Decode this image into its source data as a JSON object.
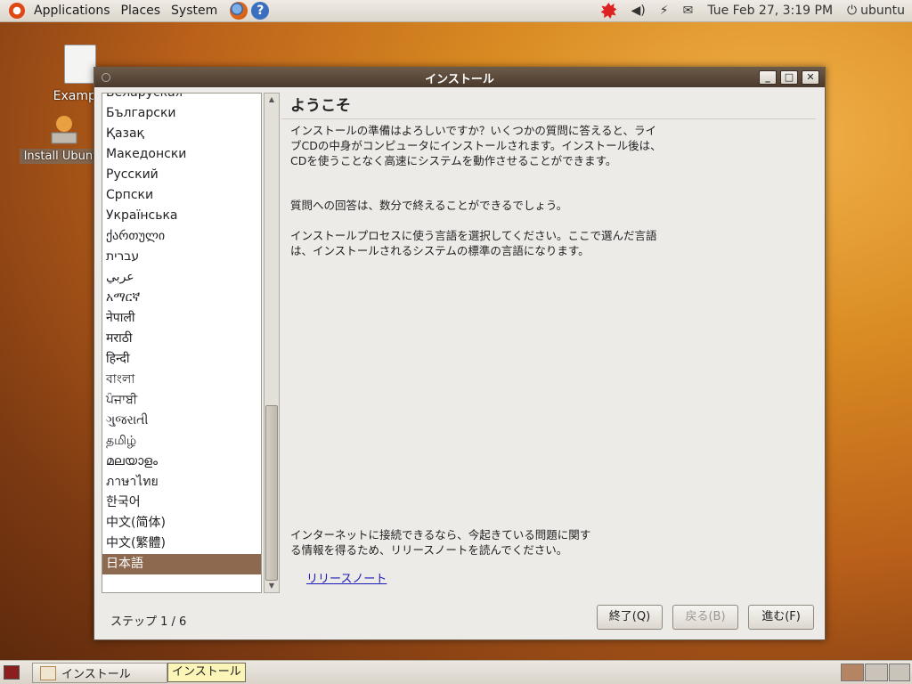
{
  "top_panel": {
    "menus": [
      "Applications",
      "Places",
      "System"
    ],
    "help_glyph": "?",
    "clock": "Tue Feb 27,  3:19 PM",
    "user": "ubuntu"
  },
  "desktop": {
    "icons": [
      {
        "label": "Example",
        "icon": "document-icon"
      },
      {
        "label": "Install Ubuntu",
        "icon": "installer-icon"
      }
    ]
  },
  "window": {
    "title": "インストール",
    "buttons": {
      "minimize": "_",
      "maximize": "□",
      "close": "✕"
    },
    "languages": [
      "Беларуская",
      "Български",
      "Қазақ",
      "Македонски",
      "Русский",
      "Српски",
      "Українська",
      "ქართული",
      "עברית",
      "عربي",
      "አማርኛ",
      "नेपाली",
      "मराठी",
      "हिन्दी",
      "বাংলা",
      "ਪੰਜਾਬੀ",
      "ગુજરાતી",
      "தமிழ்",
      "മലയാളം",
      "ภาษาไทย",
      "한국어",
      "中文(简体)",
      "中文(繁體)",
      "日本語"
    ],
    "selected_language": "日本語",
    "heading": "ようこそ",
    "para1": "インストールの準備はよろしいですか？いくつかの質問に答えると、ライブCDの中身がコンピュータにインストールされます。インストール後は、CDを使うことなく高速にシステムを動作させることができます。",
    "para2": "質問への回答は、数分で終えることができるでしょう。",
    "para3": "インストールプロセスに使う言語を選択してください。ここで選んだ言語は、インストールされるシステムの標準の言語になります。",
    "para4": "インターネットに接続できるなら、今起きている問題に関する情報を得るため、リリースノートを読んでください。",
    "release_notes_link": "リリースノート",
    "step": "ステップ 1 / 6",
    "quit_button": "終了(Q)",
    "back_button": "戻る(B)",
    "forward_button": "進む(F)"
  },
  "bottom_panel": {
    "task_label": "インストール",
    "tooltip": "インストール"
  }
}
